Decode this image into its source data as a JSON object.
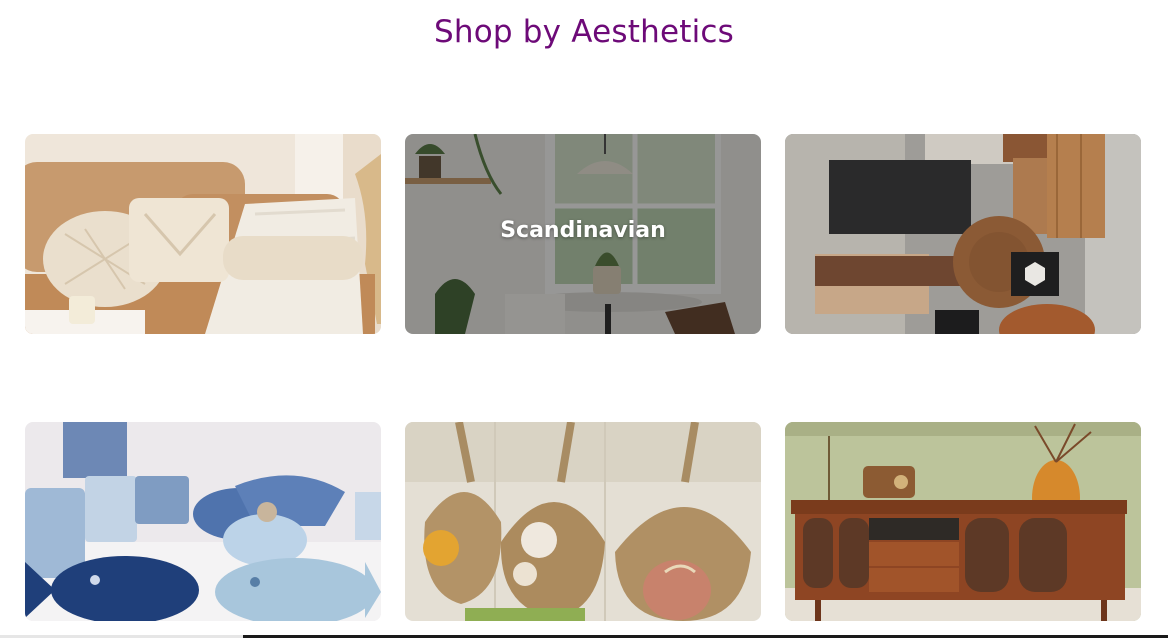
{
  "section": {
    "title": "Shop by Aesthetics"
  },
  "cards": [
    {
      "name": "boho",
      "label": "",
      "hovered": false
    },
    {
      "name": "scandinavian",
      "label": "Scandinavian",
      "hovered": true
    },
    {
      "name": "industrial",
      "label": "",
      "hovered": false
    },
    {
      "name": "coastal",
      "label": "",
      "hovered": false
    },
    {
      "name": "rustic",
      "label": "",
      "hovered": false
    },
    {
      "name": "mid-century",
      "label": "",
      "hovered": false
    }
  ],
  "colors": {
    "title": "#6d0a78",
    "overlay_text": "#ffffff"
  }
}
